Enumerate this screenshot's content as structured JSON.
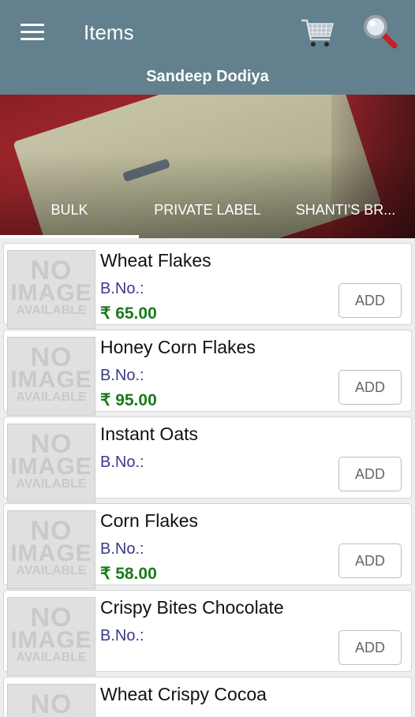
{
  "header": {
    "title": "Items",
    "subtitle": "Sandeep Dodiya",
    "icons": [
      "menu-icon",
      "cart-icon",
      "search-icon"
    ]
  },
  "tabs": [
    {
      "label": "BULK",
      "selected": true
    },
    {
      "label": "PRIVATE LABEL"
    },
    {
      "label": "SHANTI'S BR..."
    }
  ],
  "placeholder_image": {
    "line1": "NO",
    "line2": "IMAGE",
    "line3": "AVAILABLE"
  },
  "items": [
    {
      "name": "Wheat Flakes",
      "bno": "B.No.:",
      "price": "₹ 65.00",
      "add": "ADD"
    },
    {
      "name": "Honey Corn Flakes",
      "bno": "B.No.:",
      "price": "₹ 95.00",
      "add": "ADD"
    },
    {
      "name": "Instant Oats",
      "bno": "B.No.:",
      "price": "",
      "add": "ADD"
    },
    {
      "name": "Corn Flakes",
      "bno": "B.No.:",
      "price": "₹ 58.00",
      "add": "ADD"
    },
    {
      "name": "Crispy Bites Chocolate",
      "bno": "B.No.:",
      "price": "",
      "add": "ADD"
    },
    {
      "name": "Wheat Crispy Cocoa",
      "bno": "",
      "price": "",
      "add": ""
    }
  ],
  "colors": {
    "appbar": "#62808e",
    "price": "#1a7a1a",
    "bno": "#3a3a8c",
    "banner": "#8a1f24"
  }
}
